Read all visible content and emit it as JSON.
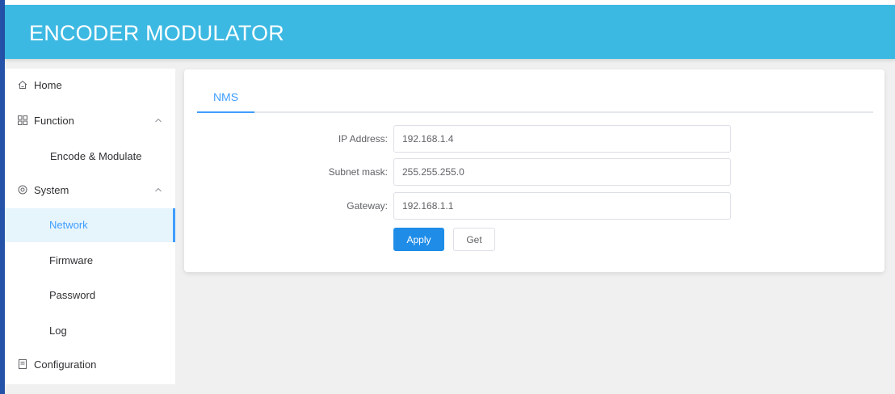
{
  "app": {
    "title": "ENCODER MODULATOR"
  },
  "colors": {
    "header": "#3cb9e2",
    "accent": "#409eff",
    "primary_button": "#1f8de8",
    "left_edge": "#2452a8"
  },
  "sidebar": {
    "home": {
      "label": "Home",
      "icon": "home-icon"
    },
    "function": {
      "label": "Function",
      "icon": "grid-icon",
      "expanded": true,
      "items": [
        {
          "label": "Encode & Modulate"
        }
      ]
    },
    "system": {
      "label": "System",
      "icon": "gear-icon",
      "expanded": true,
      "items": [
        {
          "label": "Network",
          "active": true
        },
        {
          "label": "Firmware"
        },
        {
          "label": "Password"
        },
        {
          "label": "Log"
        }
      ]
    },
    "configuration": {
      "label": "Configuration",
      "icon": "document-icon"
    }
  },
  "main": {
    "tabs": [
      {
        "label": "NMS",
        "active": true
      }
    ],
    "form": {
      "ip_address": {
        "label": "IP Address:",
        "value": "192.168.1.4"
      },
      "subnet_mask": {
        "label": "Subnet mask:",
        "value": "255.255.255.0"
      },
      "gateway": {
        "label": "Gateway:",
        "value": "192.168.1.1"
      }
    },
    "buttons": {
      "apply": "Apply",
      "get": "Get"
    }
  }
}
